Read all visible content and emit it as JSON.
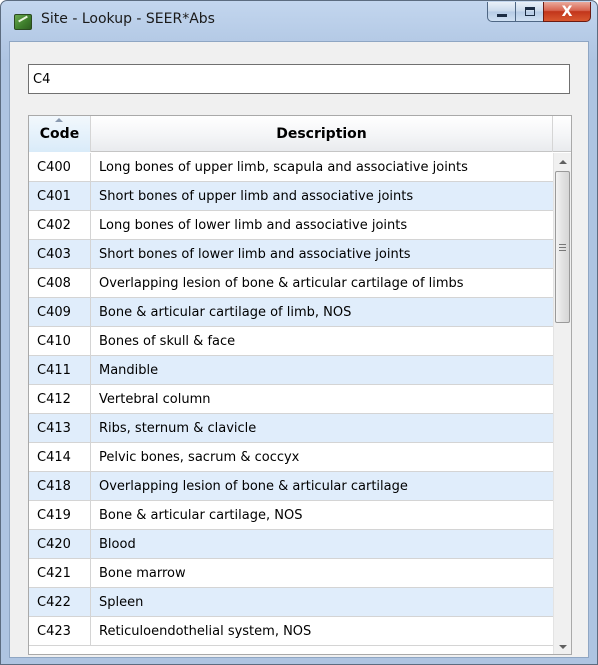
{
  "window": {
    "title": "Site - Lookup - SEER*Abs",
    "minimize_label": "",
    "maximize_label": "",
    "close_label": "X"
  },
  "search": {
    "value": "C4"
  },
  "grid": {
    "columns": [
      "Code",
      "Description"
    ],
    "sorted_column": "Code",
    "rows": [
      {
        "code": "C400",
        "description": "Long bones of upper limb, scapula and associative joints"
      },
      {
        "code": "C401",
        "description": "Short bones of upper limb and associative joints"
      },
      {
        "code": "C402",
        "description": "Long bones of lower limb and associative joints"
      },
      {
        "code": "C403",
        "description": "Short bones of lower limb and associative joints"
      },
      {
        "code": "C408",
        "description": "Overlapping lesion of bone & articular cartilage of limbs"
      },
      {
        "code": "C409",
        "description": "Bone & articular cartilage of limb, NOS"
      },
      {
        "code": "C410",
        "description": "Bones of skull & face"
      },
      {
        "code": "C411",
        "description": "Mandible"
      },
      {
        "code": "C412",
        "description": "Vertebral column"
      },
      {
        "code": "C413",
        "description": "Ribs, sternum & clavicle"
      },
      {
        "code": "C414",
        "description": "Pelvic bones, sacrum & coccyx"
      },
      {
        "code": "C418",
        "description": "Overlapping lesion of bone & articular cartilage"
      },
      {
        "code": "C419",
        "description": "Bone & articular cartilage, NOS"
      },
      {
        "code": "C420",
        "description": "Blood"
      },
      {
        "code": "C421",
        "description": "Bone marrow"
      },
      {
        "code": "C422",
        "description": "Spleen"
      },
      {
        "code": "C423",
        "description": "Reticuloendothelial system, NOS"
      }
    ]
  },
  "colors": {
    "alt_row": "#e0edfb",
    "title_bar": "#b8cde8",
    "close_button": "#c2351b"
  },
  "icons": {
    "app": "seer-abs-app-icon",
    "sort": "sort-ascending-icon"
  }
}
